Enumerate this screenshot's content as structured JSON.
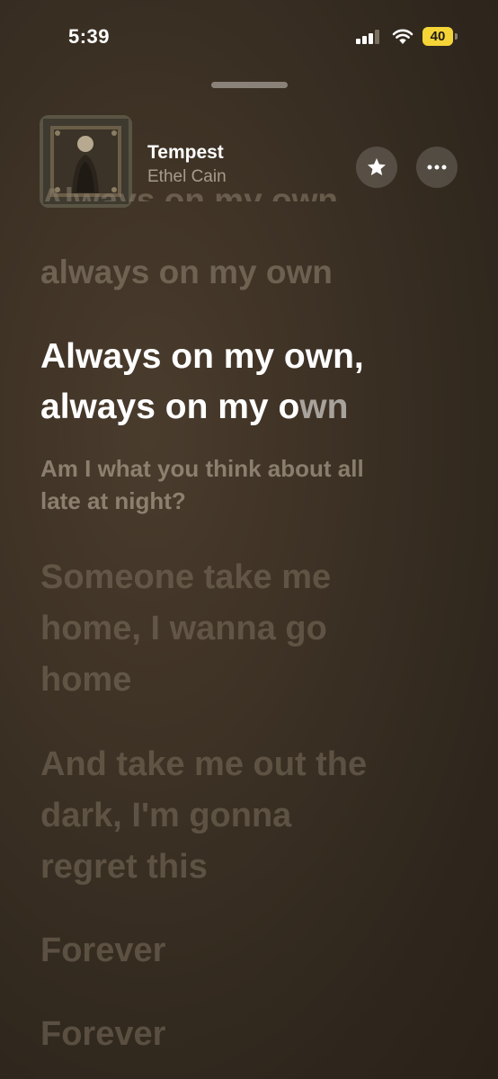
{
  "status_bar": {
    "time": "5:39",
    "battery": "40",
    "battery_color": "#f5d437"
  },
  "now_playing": {
    "title": "Tempest",
    "artist": "Ethel Cain",
    "artwork": "album-artwork",
    "favorite_icon": "star-icon",
    "more_icon": "ellipsis-icon"
  },
  "lyrics": {
    "faded_top": "Always on my own,",
    "previous": "always on my own",
    "current": {
      "line1": "Always on my own,",
      "line2_sung": "always on my o",
      "line2_rest": "wn"
    },
    "next": [
      "Am I what you think about all",
      "late at night?"
    ],
    "upcoming": [
      [
        "Someone take me",
        "home, I wanna go",
        "home"
      ],
      [
        "And take me out the",
        "dark, I'm gonna",
        "regret this"
      ],
      [
        "Forever"
      ],
      [
        "Forever"
      ]
    ]
  },
  "colors": {
    "background": "#3a2f23",
    "active_lyric": "#ffffff",
    "dim_lyric": "#8c806e"
  }
}
